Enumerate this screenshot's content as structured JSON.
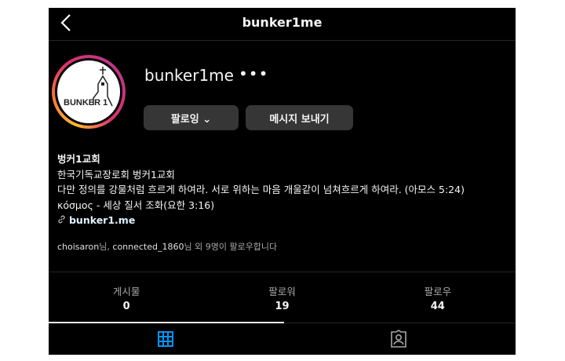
{
  "header": {
    "title": "bunker1me",
    "back_icon": "chevron-left-icon"
  },
  "profile": {
    "username": "bunker1me",
    "avatar_text": "BUNKER 1",
    "more_icon": "ellipsis-icon",
    "follow_button": "팔로잉 ⌄",
    "message_button": "메시지 보내기"
  },
  "bio": {
    "name": "벙커1교회",
    "lines": [
      "한국기독교장로회 벙커1교회",
      "다만 정의를 강물처럼 흐르게 하여라. 서로 위하는 마음 개울같이 넘쳐흐르게 하여라. (아모스 5:24)",
      "κόσμος - 세상 질서 조화(요한 3:16)"
    ],
    "link": "bunker1.me",
    "link_icon": "link-icon"
  },
  "followed_by": {
    "user1": "choisaron",
    "sep1": "님, ",
    "user2": "connected_1860",
    "rest": "님 외 9명이 팔로우합니다"
  },
  "stats": [
    {
      "label": "게시물",
      "value": "0"
    },
    {
      "label": "팔로워",
      "value": "19"
    },
    {
      "label": "팔로우",
      "value": "44"
    }
  ],
  "tabs": [
    {
      "icon": "grid-icon",
      "active": true,
      "color": "#0095f6"
    },
    {
      "icon": "tagged-person-icon",
      "active": false,
      "color": "#a8a8a8"
    }
  ]
}
